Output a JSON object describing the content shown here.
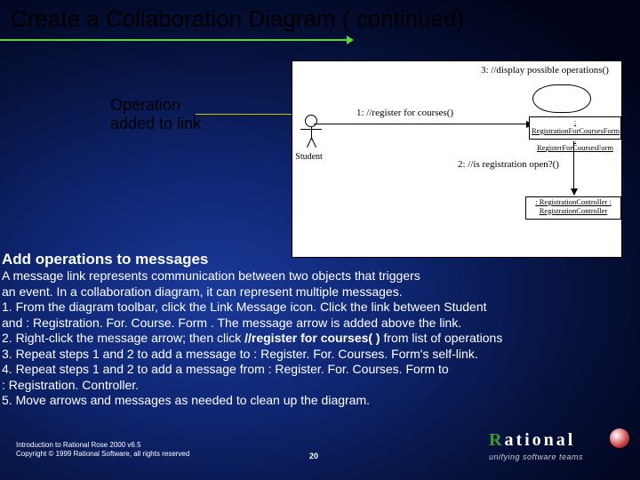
{
  "title": "Create a Collaboration Diagram ( continued)",
  "annotation": {
    "line1": "Operation",
    "line2": "added to link"
  },
  "diagram": {
    "msg3": "3: //display possible operations()",
    "msg1": "1: //register for courses()",
    "actor_label": ": Student",
    "box1_line1": ": RegistrationForCoursesForm :",
    "box1_line2": "RegisterForCoursesForm",
    "msg2": "2: //is registration open?()",
    "box2_line1": ": RegistrationController :",
    "box2_line2": "RegistrationController"
  },
  "section_heading": "Add operations to messages",
  "body": {
    "p1": "A message link represents communication between two objects that triggers",
    "p2": "an event. In a collaboration diagram, it can represent multiple messages.",
    "s1a": "1. From the diagram toolbar, click the Link Message icon. Click the link between Student",
    "s1b": " and : Registration. For. Course. Form . The message arrow is added above the link.",
    "s2a": "2. Right-click the message arrow; then click ",
    "s2b": "//register for courses( )",
    "s2c": " from list of operations",
    "s3": "3. Repeat steps 1 and 2 to add a message to : Register. For. Courses. Form's self-link.",
    "s4a": "4. Repeat steps 1 and 2 to add a message from : Register. For. Courses. Form to",
    "s4b": "  : Registration. Controller.",
    "s5": "5. Move arrows and messages as needed to clean up the diagram."
  },
  "footer": {
    "line1": "Introduction to Rational Rose 2000 v6.5",
    "line2": "Copyright © 1999 Rational Software, all rights reserved"
  },
  "page_number": "20",
  "logo": {
    "text": "Rational",
    "tagline": "unifying software teams"
  }
}
